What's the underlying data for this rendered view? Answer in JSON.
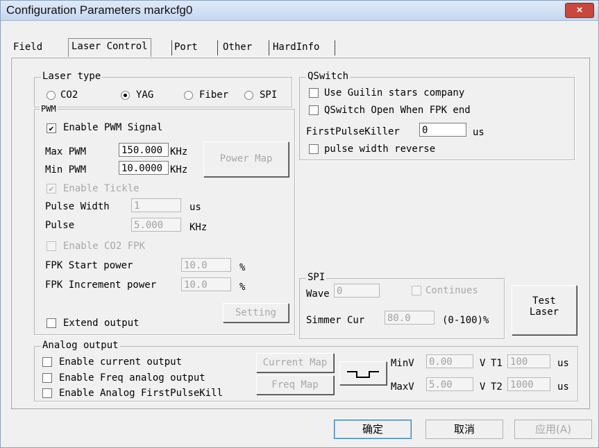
{
  "window": {
    "title": "Configuration Parameters markcfg0",
    "close": "×"
  },
  "tabs": [
    "Field",
    "Laser Control",
    "Port",
    "Other",
    "HardInfo"
  ],
  "laser_type": {
    "title": "Laser type",
    "options": [
      "CO2",
      "YAG",
      "Fiber",
      "SPI"
    ],
    "selected": "YAG"
  },
  "pwm": {
    "title": "PWM",
    "enable_pwm": "Enable PWM Signal",
    "max_label": "Max PWM",
    "max_value": "150.000",
    "max_unit": "KHz",
    "min_label": "Min PWM",
    "min_value": "10.0000",
    "min_unit": "KHz",
    "power_map": "Power Map",
    "enable_tickle": "Enable Tickle",
    "pulse_width_label": "Pulse Width",
    "pulse_width_value": "1",
    "pulse_width_unit": "us",
    "pulse_label": "Pulse",
    "pulse_value": "5.000",
    "pulse_unit": "KHz",
    "enable_co2_fpk": "Enable CO2 FPK",
    "fpk_start_label": "FPK Start power",
    "fpk_start_value": "10.0",
    "fpk_start_unit": "%",
    "fpk_inc_label": "FPK Increment power",
    "fpk_inc_value": "10.0",
    "fpk_inc_unit": "%",
    "setting": "Setting",
    "extend_output": "Extend output"
  },
  "qswitch": {
    "title": "QSwitch",
    "use_guilin": "Use Guilin stars company",
    "open_when_fpk": "QSwitch Open When FPK end",
    "fpk_label": "FirstPulseKiller",
    "fpk_value": "0",
    "fpk_unit": "us",
    "pulse_width_reverse": "pulse width reverse"
  },
  "spi": {
    "title": "SPI",
    "wave_label": "Wave",
    "wave_value": "0",
    "continues": "Continues",
    "simmer_label": "Simmer Cur",
    "simmer_value": "80.0",
    "simmer_range": "(0-100)%"
  },
  "test_laser": {
    "line1": "Test",
    "line2": "Laser"
  },
  "analog": {
    "title": "Analog output",
    "enable_current": "Enable current output",
    "enable_freq": "Enable Freq analog output",
    "enable_fpk": "Enable Analog FirstPulseKill",
    "current_map": "Current Map",
    "freq_map": "Freq Map",
    "minv_label": "MinV",
    "minv_value": "0.00",
    "v1": "V",
    "t1_label": "T1",
    "t1_value": "100",
    "t1_unit": "us",
    "maxv_label": "MaxV",
    "maxv_value": "5.00",
    "v2": "V",
    "t2_label": "T2",
    "t2_value": "1000",
    "t2_unit": "us"
  },
  "footer": {
    "ok": "确定",
    "cancel": "取消",
    "apply": "应用(A)"
  }
}
